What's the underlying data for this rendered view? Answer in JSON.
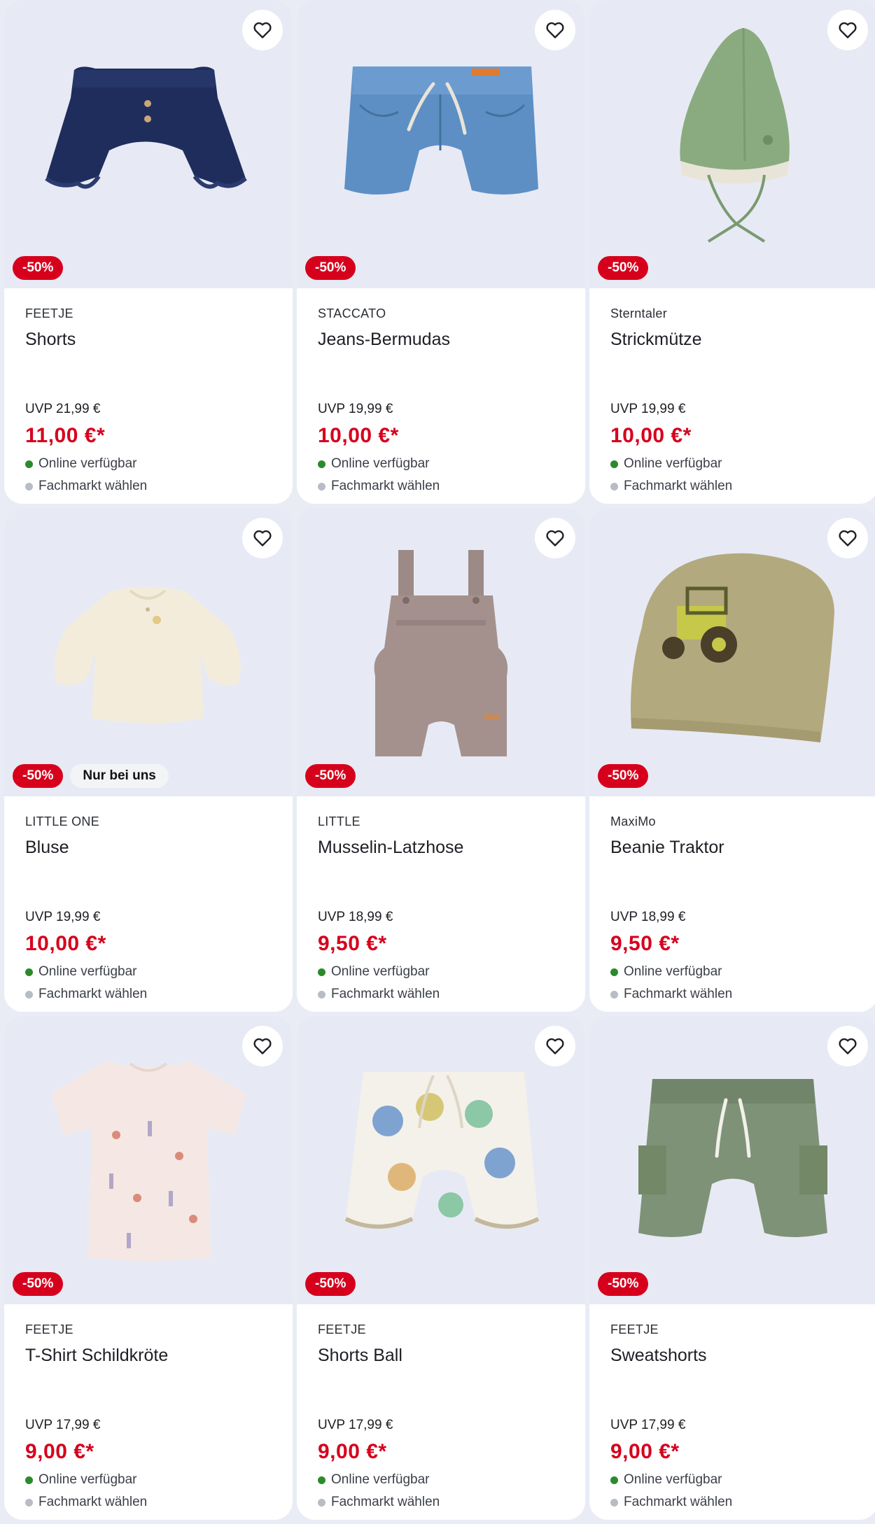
{
  "colors": {
    "sale": "#d6001c",
    "available": "#2b8a2b",
    "store": "#b8bcc4"
  },
  "products": [
    {
      "brand": "FEETJE",
      "title": "Shorts",
      "uvp": "UVP 21,99 €",
      "price": "11,00 €*",
      "discount": "-50%",
      "exclusive": "",
      "online": "Online verfügbar",
      "store": "Fachmarkt wählen",
      "image": "navy-ruffle-shorts"
    },
    {
      "brand": "STACCATO",
      "title": "Jeans-Bermudas",
      "uvp": "UVP 19,99 €",
      "price": "10,00 €*",
      "discount": "-50%",
      "exclusive": "",
      "online": "Online verfügbar",
      "store": "Fachmarkt wählen",
      "image": "denim-shorts"
    },
    {
      "brand": "Sterntaler",
      "title": "Strickmütze",
      "uvp": "UVP 19,99 €",
      "price": "10,00 €*",
      "discount": "-50%",
      "exclusive": "",
      "online": "Online verfügbar",
      "store": "Fachmarkt wählen",
      "image": "green-knit-hat"
    },
    {
      "brand": "LITTLE ONE",
      "title": "Bluse",
      "uvp": "UVP 19,99 €",
      "price": "10,00 €*",
      "discount": "-50%",
      "exclusive": "Nur bei uns",
      "online": "Online verfügbar",
      "store": "Fachmarkt wählen",
      "image": "cream-blouse"
    },
    {
      "brand": "LITTLE",
      "title": "Musselin-Latzhose",
      "uvp": "UVP 18,99 €",
      "price": "9,50 €*",
      "discount": "-50%",
      "exclusive": "",
      "online": "Online verfügbar",
      "store": "Fachmarkt wählen",
      "image": "muslin-dungarees"
    },
    {
      "brand": "MaxiMo",
      "title": "Beanie Traktor",
      "uvp": "UVP 18,99 €",
      "price": "9,50 €*",
      "discount": "-50%",
      "exclusive": "",
      "online": "Online verfügbar",
      "store": "Fachmarkt wählen",
      "image": "tractor-beanie"
    },
    {
      "brand": "FEETJE",
      "title": "T-Shirt Schildkröte",
      "uvp": "UVP 17,99 €",
      "price": "9,00 €*",
      "discount": "-50%",
      "exclusive": "",
      "online": "Online verfügbar",
      "store": "Fachmarkt wählen",
      "image": "turtle-tshirt"
    },
    {
      "brand": "FEETJE",
      "title": "Shorts Ball",
      "uvp": "UVP 17,99 €",
      "price": "9,00 €*",
      "discount": "-50%",
      "exclusive": "",
      "online": "Online verfügbar",
      "store": "Fachmarkt wählen",
      "image": "ball-shorts"
    },
    {
      "brand": "FEETJE",
      "title": "Sweatshorts",
      "uvp": "UVP 17,99 €",
      "price": "9,00 €*",
      "discount": "-50%",
      "exclusive": "",
      "online": "Online verfügbar",
      "store": "Fachmarkt wählen",
      "image": "green-sweatshorts"
    }
  ]
}
